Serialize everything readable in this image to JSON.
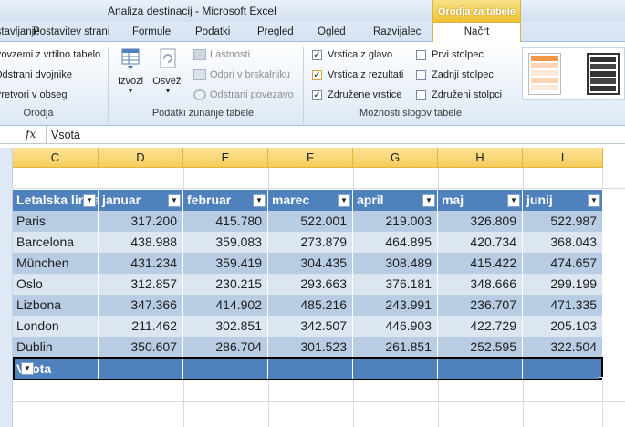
{
  "window": {
    "title": "Analiza destinacij  -  Microsoft Excel",
    "context_tab": "Orodja za tabele"
  },
  "tabs": [
    "Vstavljanje",
    "Postavitev strani",
    "Formule",
    "Podatki",
    "Pregled",
    "Ogled",
    "Razvijalec",
    "Načrt"
  ],
  "ribbon": {
    "tools_group": {
      "items": [
        "Povzemi z vrtilno tabelo",
        "Odstrani dvojnike",
        "Pretvori v obseg"
      ],
      "label": "Orodja"
    },
    "external_group": {
      "export_label": "Izvozi",
      "refresh_label": "Osveži",
      "items": [
        "Lastnosti",
        "Odpri v brskalniku",
        "Odstrani povezavo"
      ],
      "label": "Podatki zunanje tabele"
    },
    "style_options": {
      "items": [
        {
          "label": "Vrstica z glavo",
          "checked": true
        },
        {
          "label": "Vrstica z rezultati",
          "checked": true
        },
        {
          "label": "Združene vrstice",
          "checked": true
        },
        {
          "label": "Prvi stolpec",
          "checked": false
        },
        {
          "label": "Zadnji stolpec",
          "checked": false
        },
        {
          "label": "Združeni stolpci",
          "checked": false
        }
      ],
      "label": "Možnosti slogov tabele"
    }
  },
  "formula_bar": {
    "fx": "fx",
    "content": "Vsota"
  },
  "columns": [
    "C",
    "D",
    "E",
    "F",
    "G",
    "H",
    "I"
  ],
  "table": {
    "headers": [
      "Letalska linija",
      "januar",
      "februar",
      "marec",
      "april",
      "maj",
      "junij"
    ],
    "rows": [
      [
        "Paris",
        "317.200",
        "415.780",
        "522.001",
        "219.003",
        "326.809",
        "522.987"
      ],
      [
        "Barcelona",
        "438.988",
        "359.083",
        "273.879",
        "464.895",
        "420.734",
        "368.043"
      ],
      [
        "München",
        "431.234",
        "359.419",
        "304.435",
        "308.489",
        "415.422",
        "474.657"
      ],
      [
        "Oslo",
        "312.857",
        "230.215",
        "293.663",
        "376.181",
        "348.666",
        "299.199"
      ],
      [
        "Lizbona",
        "347.366",
        "414.902",
        "485.216",
        "243.991",
        "236.707",
        "471.335"
      ],
      [
        "London",
        "211.462",
        "302.851",
        "342.507",
        "446.903",
        "422.729",
        "205.103"
      ],
      [
        "Dublin",
        "350.607",
        "286.704",
        "301.523",
        "261.851",
        "252.595",
        "322.504"
      ]
    ],
    "total_label": "Vsota"
  },
  "colors": {
    "header": "#4f81bd",
    "band_dark": "#b8cce4",
    "band_light": "#dce6f1",
    "context_tab": "#f0c430"
  }
}
